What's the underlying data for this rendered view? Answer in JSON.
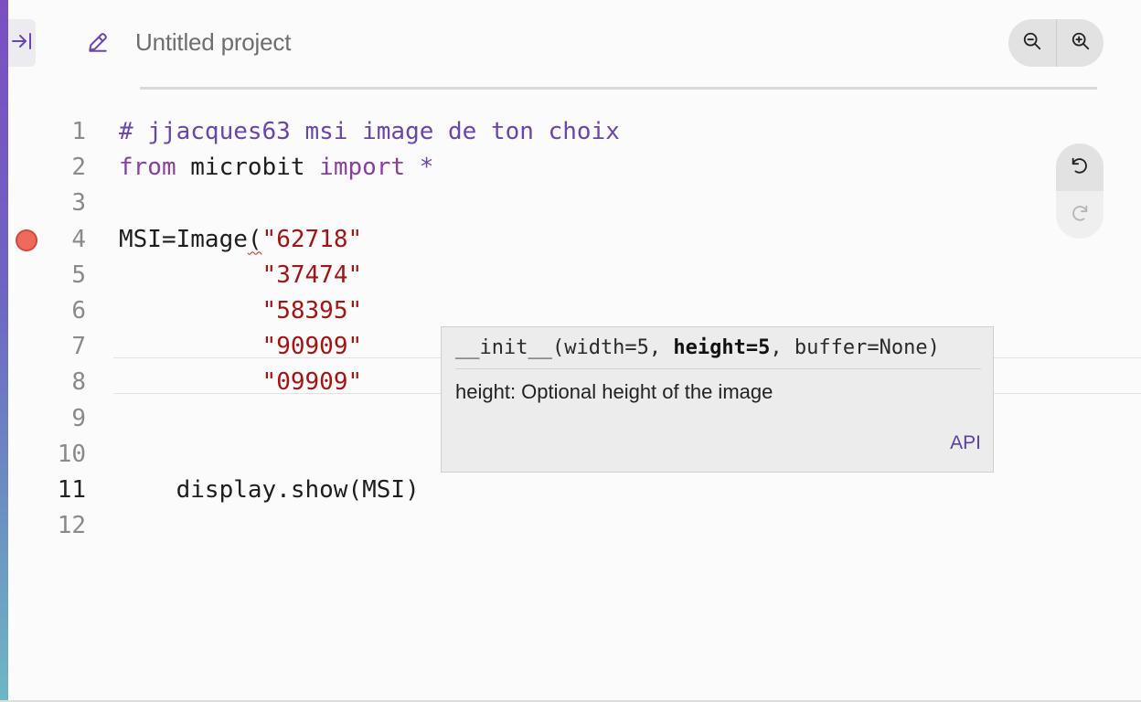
{
  "header": {
    "project_name": "Untitled project"
  },
  "icons": {
    "collapse": "collapse-sidebar-icon",
    "edit": "pencil-icon",
    "zoom_out": "zoom-out-icon",
    "zoom_in": "zoom-in-icon",
    "undo": "undo-icon",
    "redo": "redo-icon"
  },
  "editor": {
    "active_line": 11,
    "breakpoint_line": 4,
    "lines": [
      {
        "n": "1",
        "tokens": [
          {
            "t": "# jjacques63 msi image de ton choix",
            "c": "comment"
          }
        ]
      },
      {
        "n": "2",
        "tokens": [
          {
            "t": "from",
            "c": "keyword"
          },
          {
            "t": " microbit ",
            "c": "plain"
          },
          {
            "t": "import",
            "c": "keyword"
          },
          {
            "t": " *",
            "c": "comment"
          }
        ]
      },
      {
        "n": "3",
        "tokens": []
      },
      {
        "n": "4",
        "tokens": [
          {
            "t": "MSI=Image",
            "c": "plain"
          },
          {
            "t": "(",
            "c": "squiggle"
          },
          {
            "t": "\"62718\"",
            "c": "string"
          }
        ]
      },
      {
        "n": "5",
        "tokens": [
          {
            "t": "          ",
            "c": "plain"
          },
          {
            "t": "\"37474\"",
            "c": "string"
          }
        ]
      },
      {
        "n": "6",
        "tokens": [
          {
            "t": "          ",
            "c": "plain"
          },
          {
            "t": "\"58395\"",
            "c": "string"
          }
        ]
      },
      {
        "n": "7",
        "tokens": [
          {
            "t": "          ",
            "c": "plain"
          },
          {
            "t": "\"90909\"",
            "c": "string"
          }
        ]
      },
      {
        "n": "8",
        "tokens": [
          {
            "t": "          ",
            "c": "plain"
          },
          {
            "t": "\"09909\"",
            "c": "string"
          }
        ]
      },
      {
        "n": "9",
        "tokens": []
      },
      {
        "n": "10",
        "tokens": []
      },
      {
        "n": "11",
        "tokens": [
          {
            "t": "    display.show(MSI)",
            "c": "plain"
          }
        ]
      },
      {
        "n": "12",
        "tokens": []
      }
    ]
  },
  "signature_help": {
    "prefix": "__init__(width=5, ",
    "active_param": "height=5",
    "suffix": ", buffer=None)",
    "doc": "height: Optional height of the image",
    "link": "API"
  },
  "colors": {
    "accent": "#6a45ad",
    "string": "#a31515",
    "keyword": "#8a3fa0",
    "breakpoint": "#ee6a5a"
  }
}
